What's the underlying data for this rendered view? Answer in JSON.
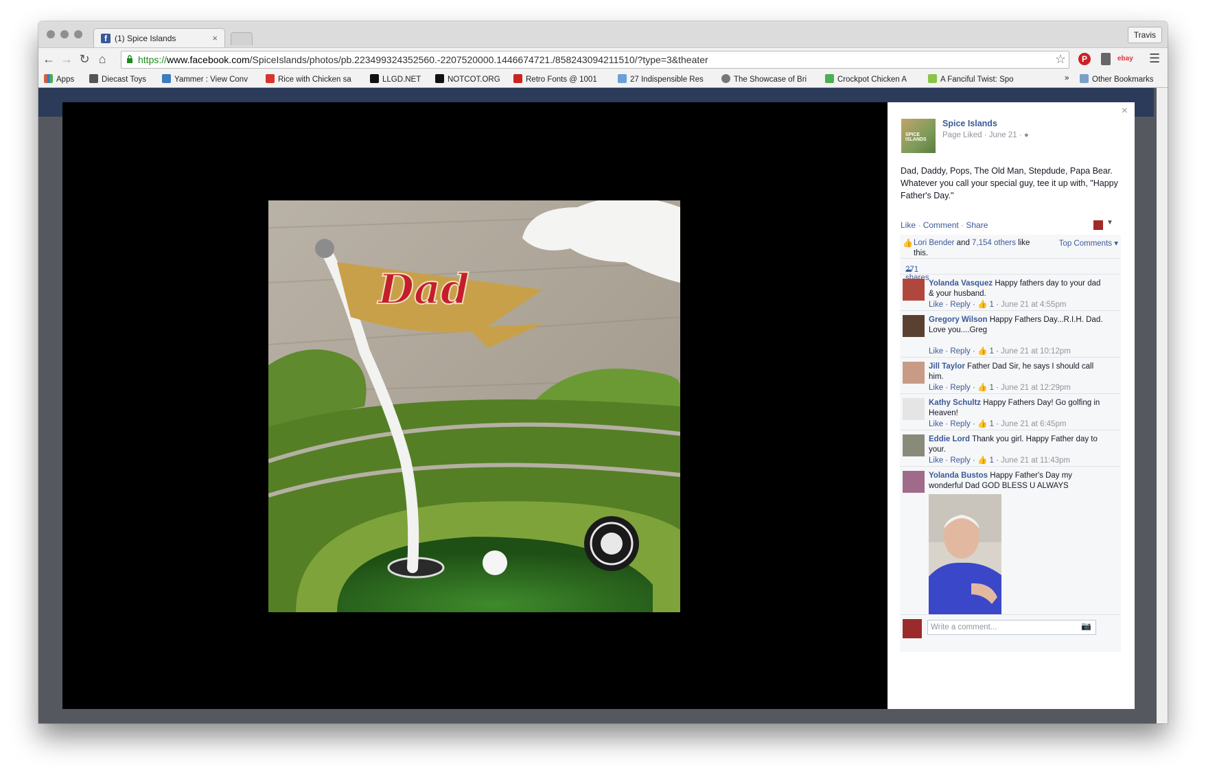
{
  "browser": {
    "tab_title": "(1) Spice Islands",
    "tab_close": "×",
    "profile_name": "Travis",
    "url_protocol": "https://",
    "url_host": "www.facebook.com",
    "url_path": "/SpiceIslands/photos/pb.223499324352560.-2207520000.1446674721./858243094211510/?type=3&theater"
  },
  "bookmarks": [
    {
      "label": "Apps",
      "icon": "apps-grid-icon",
      "color": "#e25b3a"
    },
    {
      "label": "Diecast Toys",
      "icon": "page-icon",
      "color": "#555555"
    },
    {
      "label": "Yammer : View Conv",
      "icon": "yammer-icon",
      "color": "#3b7bbf"
    },
    {
      "label": "Rice with Chicken sa",
      "icon": "recipe-icon",
      "color": "#d9342b"
    },
    {
      "label": "LLGD.NET",
      "icon": "llgd-icon",
      "color": "#111111"
    },
    {
      "label": "NOTCOT.ORG",
      "icon": "notcot-icon",
      "color": "#111111"
    },
    {
      "label": "Retro Fonts @ 1001",
      "icon": "fonts-icon",
      "color": "#cc2222"
    },
    {
      "label": "27 Indispensible Res",
      "icon": "article-icon",
      "color": "#6aa0d8"
    },
    {
      "label": "The Showcase of Bri",
      "icon": "showcase-icon",
      "color": "#777777"
    },
    {
      "label": "Crockpot Chicken A",
      "icon": "crockpot-icon",
      "color": "#4caf50"
    },
    {
      "label": "A Fanciful Twist: Spo",
      "icon": "blog-icon",
      "color": "#8bc34a"
    }
  ],
  "bookmarks_overflow": "»",
  "other_bookmarks": "Other Bookmarks",
  "post": {
    "page_name": "Spice Islands",
    "meta": "Page Liked · June 21 ·",
    "avatar_text": "SPICE ISLANDS",
    "text": "Dad, Daddy, Pops, The Old Man, Stepdude, Papa Bear. Whatever you call your special guy, tee it up with, \"Happy Father's Day.\"",
    "actions": {
      "like": "Like",
      "comment": "Comment",
      "share": "Share",
      "sep": " · "
    },
    "close": "×",
    "photo_text": "Dad"
  },
  "likes": {
    "first_liker": "Lori Bender",
    "and": " and ",
    "others": "7,154 others",
    "suffix": " like this.",
    "top_comments": "Top Comments ▾"
  },
  "shares": "271 shares",
  "comments": [
    {
      "author": "Yolanda Vasquez",
      "text": "Happy fathers day to your dad & your husband.",
      "likes": "1",
      "time": "June 21 at 4:55pm"
    },
    {
      "author": "Gregory Wilson",
      "text": "Happy Fathers Day...R.I.H. Dad.\nLove you....Greg",
      "likes": "1",
      "time": "June 21 at 10:12pm"
    },
    {
      "author": "Jill Taylor",
      "text": "Father Dad Sir, he says I should call him.",
      "likes": "1",
      "time": "June 21 at 12:29pm"
    },
    {
      "author": "Kathy Schultz",
      "text": "Happy Fathers Day! Go golfing in Heaven!",
      "likes": "1",
      "time": "June 21 at 6:45pm"
    },
    {
      "author": "Eddie Lord",
      "text": "Thank you girl. Happy Father day to your.",
      "likes": "1",
      "time": "June 21 at 11:43pm"
    },
    {
      "author": "Yolanda Bustos",
      "text": "Happy Father's Day my wonderful Dad GOD BLESS U ALWAYS",
      "likes": "",
      "time": ""
    }
  ],
  "comment_labels": {
    "like": "Like",
    "reply": "Reply"
  },
  "write_comment_placeholder": "Write a comment...",
  "colors": {
    "facebook_blue": "#3b5998",
    "theater_bg": "#000000"
  }
}
